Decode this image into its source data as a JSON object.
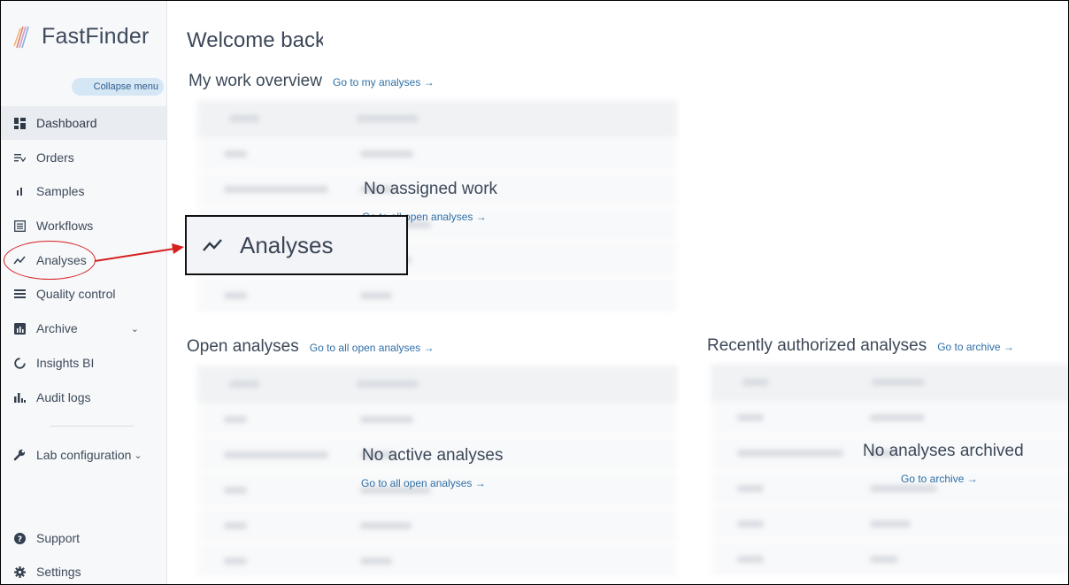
{
  "brand": {
    "name": "FastFinder"
  },
  "sidebar": {
    "collapse_label": "Collapse menu",
    "items": [
      {
        "label": "Dashboard",
        "icon": "dashboard-icon"
      },
      {
        "label": "Orders",
        "icon": "orders-icon"
      },
      {
        "label": "Samples",
        "icon": "samples-icon"
      },
      {
        "label": "Workflows",
        "icon": "workflows-icon"
      },
      {
        "label": "Analyses",
        "icon": "analyses-icon"
      },
      {
        "label": "Quality control",
        "icon": "quality-control-icon"
      },
      {
        "label": "Archive",
        "icon": "archive-icon"
      },
      {
        "label": "Insights BI",
        "icon": "insights-icon"
      },
      {
        "label": "Audit logs",
        "icon": "audit-logs-icon"
      },
      {
        "label": "Lab configuration",
        "icon": "wrench-icon"
      },
      {
        "label": "Support",
        "icon": "help-icon"
      },
      {
        "label": "Settings",
        "icon": "gear-icon"
      }
    ]
  },
  "main": {
    "welcome": "Welcome back",
    "my_work": {
      "title": "My work overview",
      "link": "Go to my analyses →",
      "empty": "No assigned work",
      "empty_link": "Go to all open analyses →"
    },
    "open_analyses": {
      "title": "Open analyses",
      "link": "Go to all open analyses →",
      "empty": "No active analyses",
      "empty_link": "Go to all open analyses →"
    },
    "recent": {
      "title": "Recently authorized analyses",
      "link": "Go to archive →",
      "empty": "No analyses archived",
      "empty_link": "Go to archive →"
    }
  },
  "callout": {
    "label": "Analyses",
    "color": "#d61f1f"
  }
}
